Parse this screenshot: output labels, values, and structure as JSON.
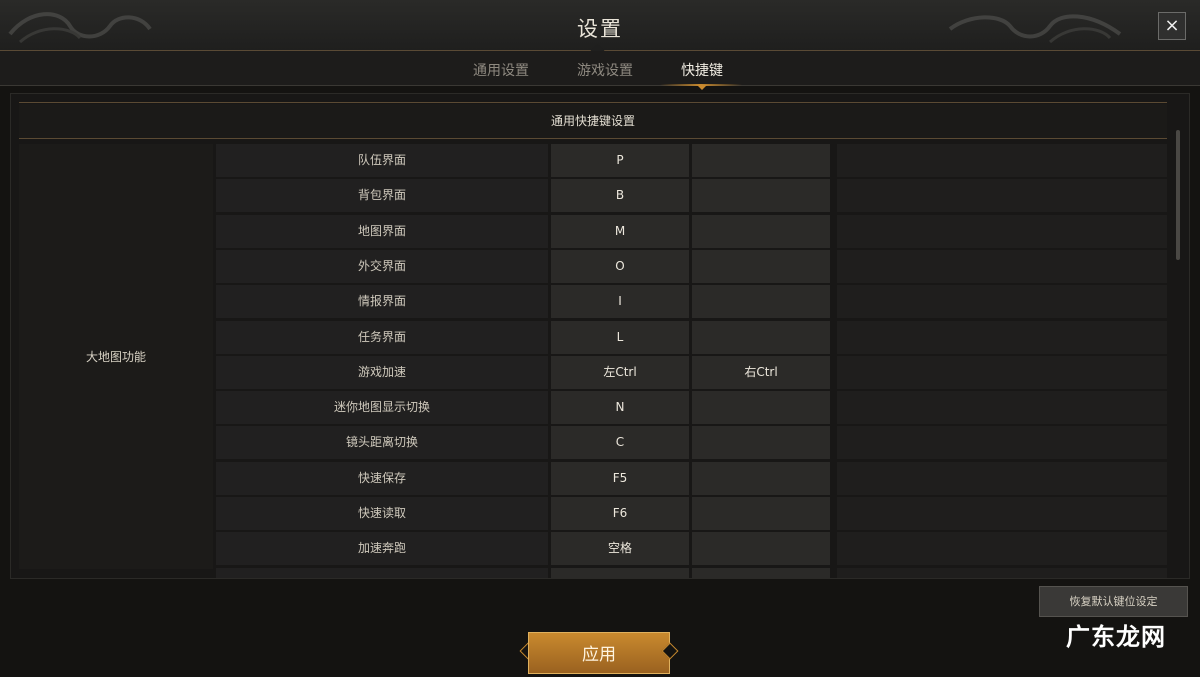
{
  "window": {
    "title": "设置",
    "close_label": "×"
  },
  "tabs": [
    {
      "label": "通用设置",
      "active": false
    },
    {
      "label": "游戏设置",
      "active": false
    },
    {
      "label": "快捷键",
      "active": true
    }
  ],
  "section": {
    "title": "通用快捷键设置"
  },
  "group": {
    "label": "大地图功能"
  },
  "rows": [
    {
      "action": "队伍界面",
      "key1": "P",
      "key2": ""
    },
    {
      "action": "背包界面",
      "key1": "B",
      "key2": ""
    },
    {
      "action": "地图界面",
      "key1": "M",
      "key2": ""
    },
    {
      "action": "外交界面",
      "key1": "O",
      "key2": ""
    },
    {
      "action": "情报界面",
      "key1": "I",
      "key2": ""
    },
    {
      "action": "任务界面",
      "key1": "L",
      "key2": ""
    },
    {
      "action": "游戏加速",
      "key1": "左Ctrl",
      "key2": "右Ctrl"
    },
    {
      "action": "迷你地图显示切换",
      "key1": "N",
      "key2": ""
    },
    {
      "action": "镜头距离切换",
      "key1": "C",
      "key2": ""
    },
    {
      "action": "快速保存",
      "key1": "F5",
      "key2": ""
    },
    {
      "action": "快速读取",
      "key1": "F6",
      "key2": ""
    },
    {
      "action": "加速奔跑",
      "key1": "空格",
      "key2": ""
    },
    {
      "action": "",
      "key1": "",
      "key2": ""
    }
  ],
  "buttons": {
    "restore_defaults": "恢复默认键位设定",
    "apply": "应用"
  },
  "watermark": "广东龙网",
  "colors": {
    "accent": "#c98a2e",
    "background": "#141311"
  }
}
